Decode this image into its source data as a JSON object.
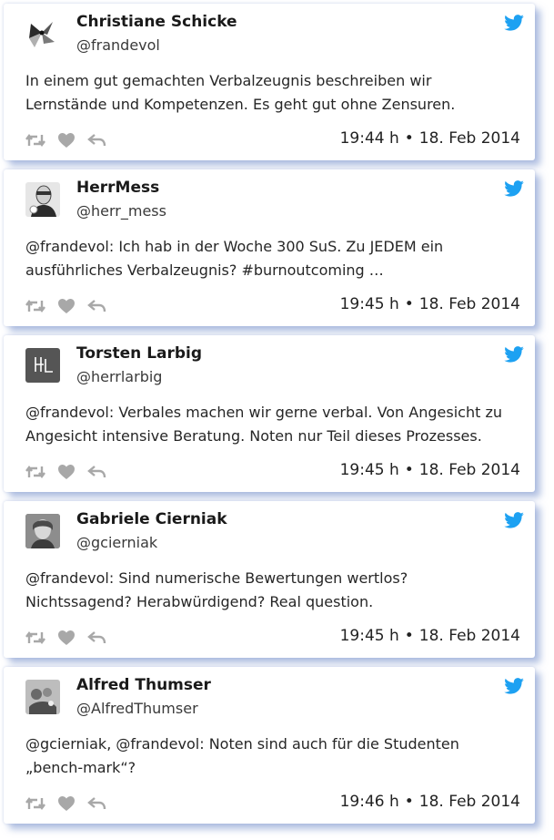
{
  "colors": {
    "twitter_blue": "#1da1f2",
    "action_gray": "#a8a8a8"
  },
  "icons": {
    "brand": "twitter-bird-icon",
    "retweet": "retweet-icon",
    "like": "heart-icon",
    "reply": "reply-icon"
  },
  "tweets": [
    {
      "name": "Christiane Schicke",
      "handle": "@frandevol",
      "text": "In einem gut gemachten Verbalzeugnis beschreiben wir Lernstände und Kompetenzen. Es geht gut ohne Zensuren.",
      "time": "19:44 h",
      "date": "18. Feb 2014"
    },
    {
      "name": "HerrMess",
      "handle": "@herr_mess",
      "text": "@frandevol: Ich hab in der Woche 300 SuS. Zu JEDEM ein ausführliches Verbalzeugnis? #burnoutcoming …",
      "time": "19:45 h",
      "date": "18. Feb 2014"
    },
    {
      "name": "Torsten Larbig",
      "handle": "@herrlarbig",
      "text": "@frandevol: Verbales machen wir gerne verbal. Von Angesicht zu Angesicht intensive Beratung. Noten nur Teil dieses Prozesses.",
      "time": "19:45 h",
      "date": "18. Feb 2014"
    },
    {
      "name": "Gabriele Cierniak",
      "handle": "@gcierniak",
      "text": "@frandevol: Sind numerische Bewertungen wertlos? Nichtssagend? Herabwürdigend? Real question.",
      "time": "19:45 h",
      "date": "18. Feb 2014"
    },
    {
      "name": "Alfred Thumser",
      "handle": "@AlfredThumser",
      "text": "@gcierniak, @frandevol: Noten sind auch für die Studenten „bench-mark“?",
      "time": "19:46 h",
      "date": "18. Feb 2014"
    }
  ]
}
